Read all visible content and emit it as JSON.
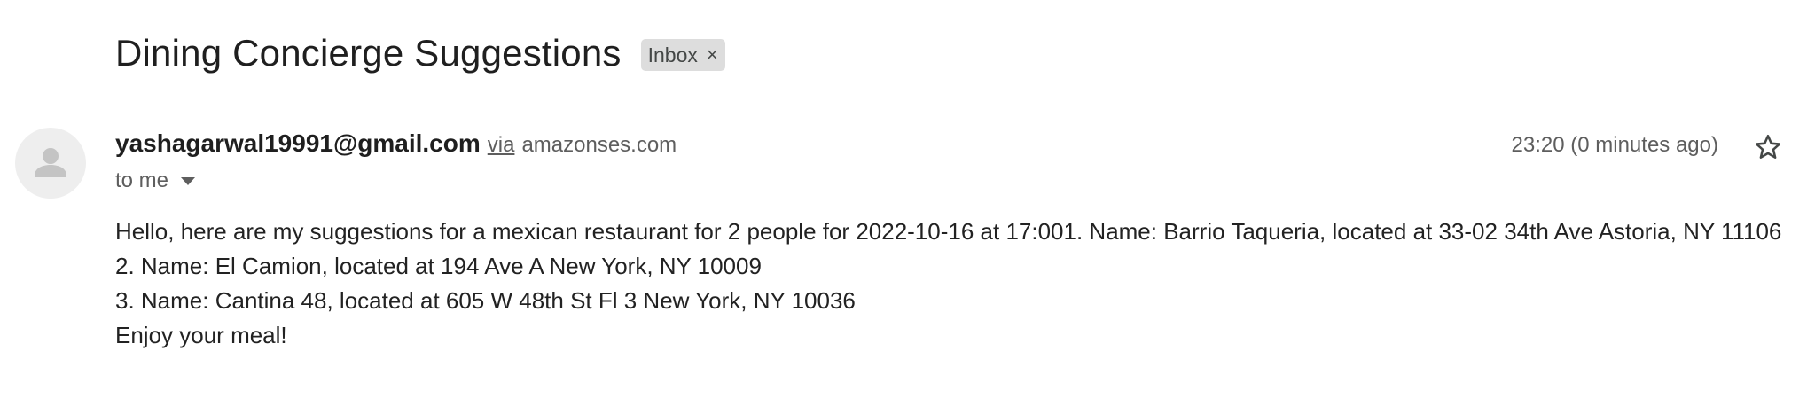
{
  "email": {
    "subject": "Dining Concierge Suggestions",
    "label": "Inbox",
    "label_close": "×",
    "sender": "yashagarwal19991@gmail.com",
    "via_label": "via",
    "via_domain": "amazonses.com",
    "timestamp": "23:20 (0 minutes ago)",
    "recipient": "to me",
    "body_lines": [
      "Hello, here are my suggestions for a mexican restaurant for 2 people for 2022-10-16 at 17:001. Name: Barrio Taqueria, located at 33-02 34th Ave Astoria, NY 11106",
      "2. Name: El Camion, located at 194 Ave A New York, NY 10009",
      "3. Name: Cantina 48, located at 605 W 48th St Fl 3 New York, NY 10036",
      "Enjoy your meal!"
    ]
  },
  "icons": {
    "avatar": "default-person-avatar",
    "star": "star-outline-icon",
    "caret": "caret-down-icon",
    "chip_close": "close-icon"
  },
  "colors": {
    "chip_background": "#dddddd",
    "secondary_text": "#5e5e5e",
    "primary_text": "#1f1f1f",
    "avatar_background": "#eeeeee"
  }
}
